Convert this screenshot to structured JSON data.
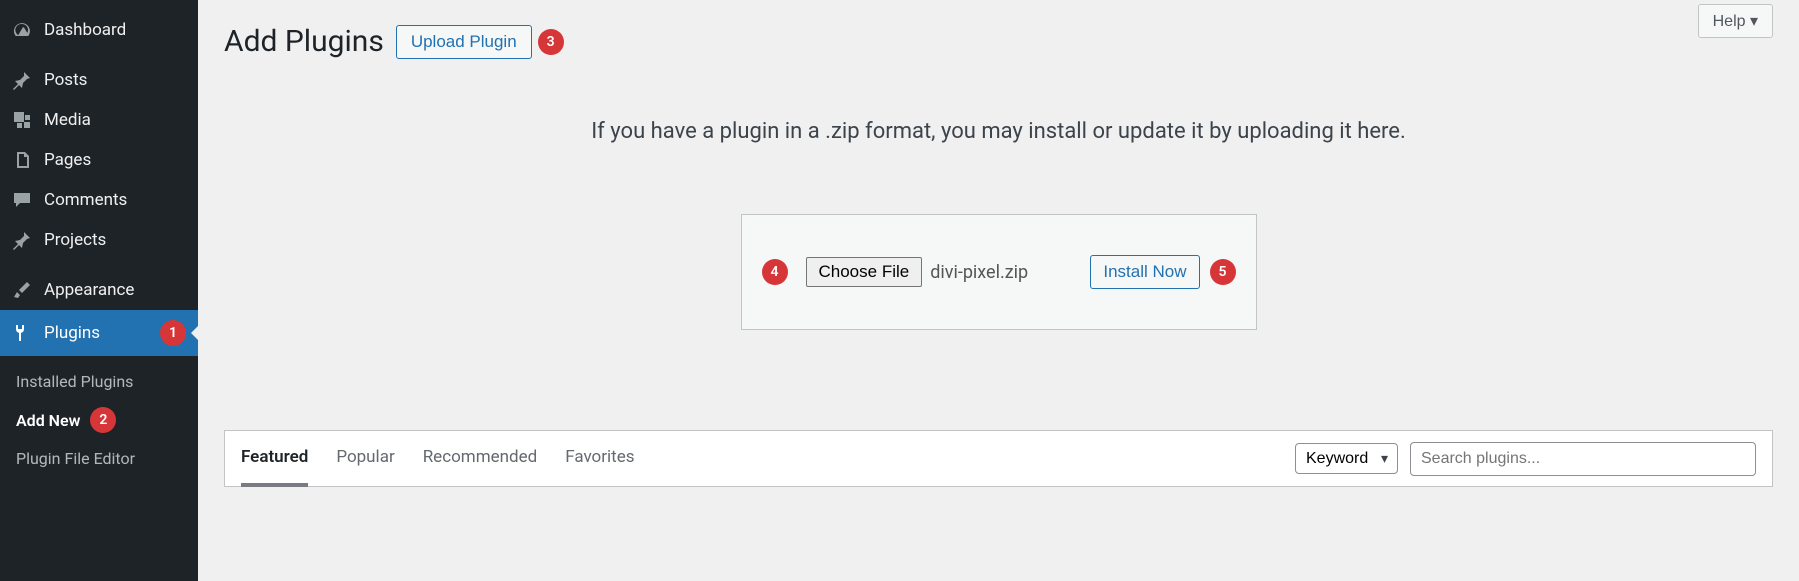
{
  "sidebar": {
    "dashboard": "Dashboard",
    "posts": "Posts",
    "media": "Media",
    "pages": "Pages",
    "comments": "Comments",
    "projects": "Projects",
    "appearance": "Appearance",
    "plugins": "Plugins",
    "plugins_badge": "1",
    "submenu": {
      "installed": "Installed Plugins",
      "add_new": "Add New",
      "add_new_badge": "2",
      "file_editor": "Plugin File Editor"
    }
  },
  "header": {
    "title": "Add Plugins",
    "upload_btn": "Upload Plugin",
    "upload_badge": "3",
    "help_btn": "Help ▾"
  },
  "upload": {
    "instruction": "If you have a plugin in a .zip format, you may install or update it by uploading it here.",
    "choose_badge": "4",
    "choose_btn": "Choose File",
    "filename": "divi-pixel.zip",
    "install_btn": "Install Now",
    "install_badge": "5"
  },
  "filter": {
    "tabs": {
      "featured": "Featured",
      "popular": "Popular",
      "recommended": "Recommended",
      "favorites": "Favorites"
    },
    "search_type": "Keyword",
    "search_placeholder": "Search plugins..."
  }
}
